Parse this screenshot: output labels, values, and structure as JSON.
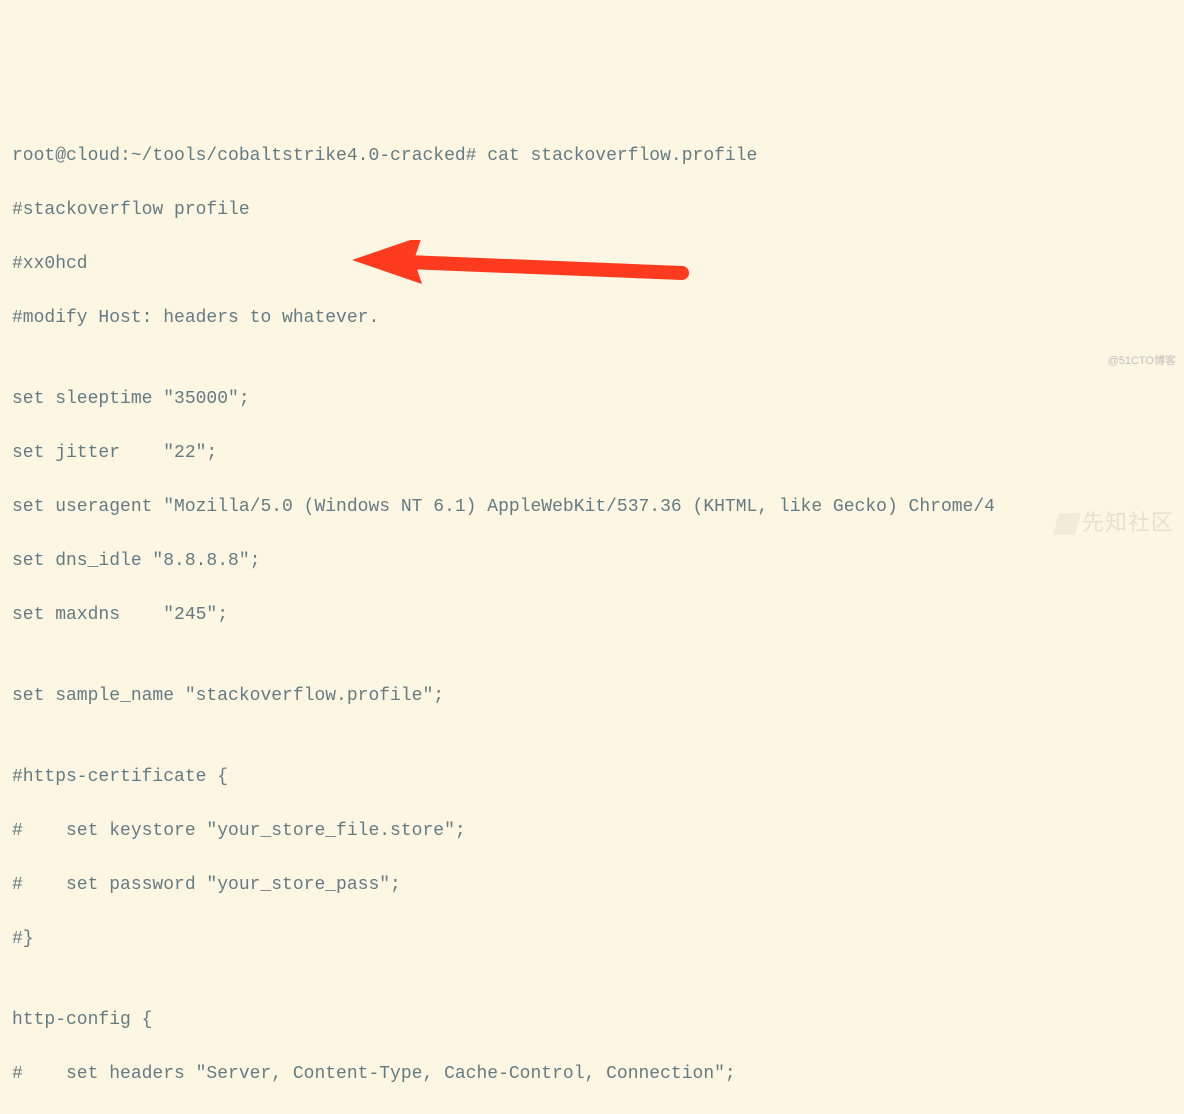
{
  "terminal": {
    "lines": [
      "root@cloud:~/tools/cobaltstrike4.0-cracked# cat stackoverflow.profile",
      "#stackoverflow profile",
      "#xx0hcd",
      "#modify Host: headers to whatever.",
      "",
      "set sleeptime \"35000\";",
      "set jitter    \"22\";",
      "set useragent \"Mozilla/5.0 (Windows NT 6.1) AppleWebKit/537.36 (KHTML, like Gecko) Chrome/4",
      "set dns_idle \"8.8.8.8\";",
      "set maxdns    \"245\";",
      "",
      "set sample_name \"stackoverflow.profile\";",
      "",
      "#https-certificate {",
      "#    set keystore \"your_store_file.store\";",
      "#    set password \"your_store_pass\";",
      "#}",
      "",
      "http-config {",
      "#    set headers \"Server, Content-Type, Cache-Control, Connection\";"
    ]
  },
  "annotations": {
    "arrow_color": "#ff3b1f"
  },
  "watermarks": {
    "small": "@51CTO博客",
    "large": "先知社区"
  }
}
